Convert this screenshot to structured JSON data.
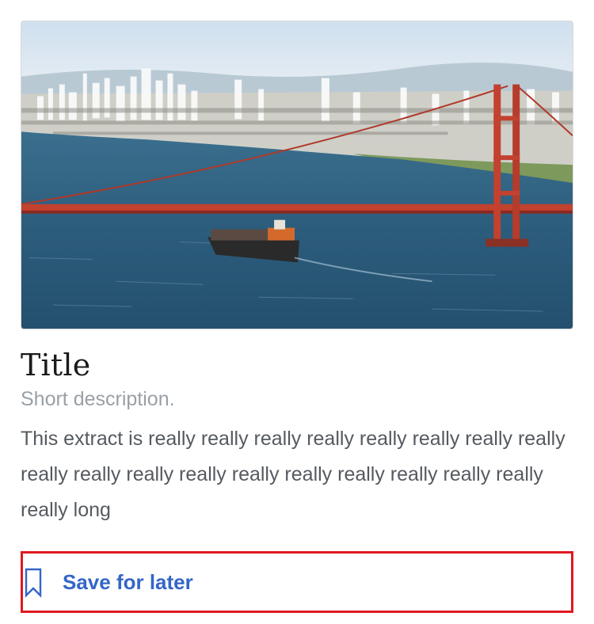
{
  "card": {
    "image": {
      "description_icon": "golden-gate-bridge-photo"
    },
    "title": "Title",
    "short_description": "Short description.",
    "extract": "This extract is really really really really really really really really really really really really really really really really really really really long",
    "save": {
      "label": "Save for later",
      "icon": "bookmark-icon"
    }
  },
  "colors": {
    "link_blue": "#3466c8",
    "highlight_red": "#e0191f",
    "muted_text": "#9aa0a6",
    "body_text": "#555a60"
  }
}
